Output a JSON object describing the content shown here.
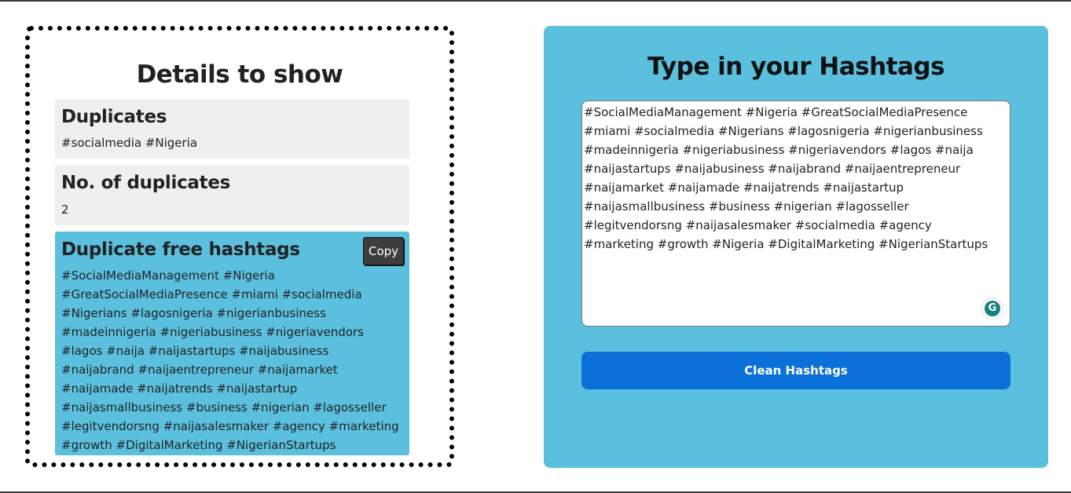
{
  "details": {
    "title": "Details to show",
    "duplicates": {
      "heading": "Duplicates",
      "value": "#socialmedia #Nigeria"
    },
    "count": {
      "heading": "No. of duplicates",
      "value": "2"
    },
    "clean": {
      "heading": "Duplicate free hashtags",
      "copy_label": "Copy",
      "value": "#SocialMediaManagement #Nigeria #GreatSocialMediaPresence #miami #socialmedia #Nigerians #lagosnigeria #nigerianbusiness #madeinnigeria #nigeriabusiness #nigeriavendors #lagos #naija #naijastartups #naijabusiness #naijabrand #naijaentrepreneur #naijamarket #naijamade #naijatrends #naijastartup #naijasmallbusiness #business #nigerian #lagosseller #legitvendorsng #naijasalesmaker #agency #marketing #growth #DigitalMarketing #NigerianStartups"
    }
  },
  "input": {
    "title": "Type in your Hashtags",
    "textarea_value": "#SocialMediaManagement #Nigeria #GreatSocialMediaPresence #miami #socialmedia #Nigerians #lagosnigeria #nigerianbusiness #madeinnigeria #nigeriabusiness #nigeriavendors #lagos #naija #naijastartups #naijabusiness #naijabrand #naijaentrepreneur #naijamarket #naijamade #naijatrends #naijastartup #naijasmallbusiness #business #nigerian #lagosseller #legitvendorsng #naijasalesmaker #socialmedia #agency #marketing #growth #Nigeria #DigitalMarketing #NigerianStartups",
    "clean_button_label": "Clean Hashtags",
    "grammarly_icon": "grammarly-icon"
  },
  "colors": {
    "panel_blue": "#5bc0de",
    "button_blue": "#0b70d7",
    "card_grey": "#efefef",
    "copy_button": "#3d3d3d"
  }
}
